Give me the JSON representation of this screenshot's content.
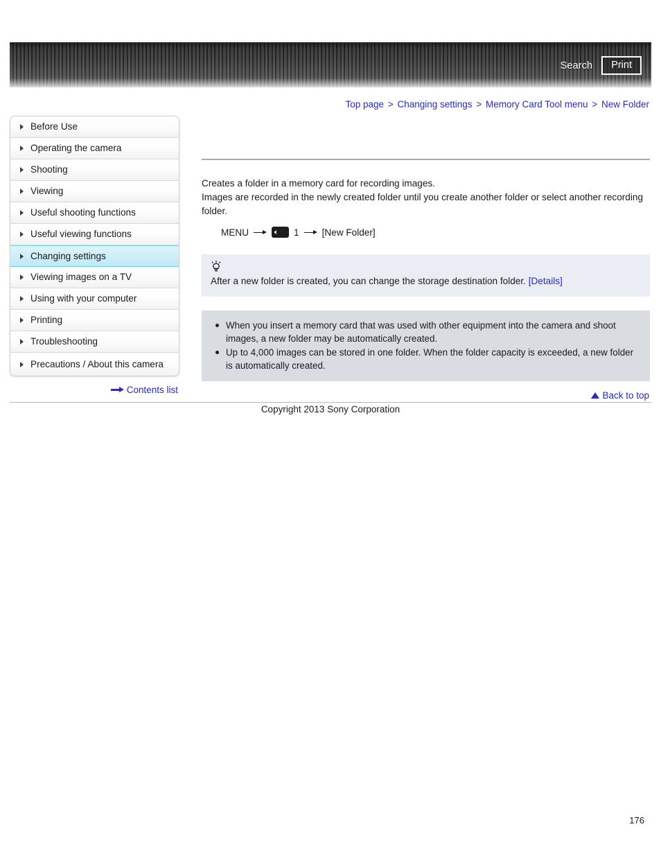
{
  "header": {
    "search_label": "Search",
    "print_label": "Print",
    "search_icon": "search-icon",
    "print_icon": "print-icon"
  },
  "breadcrumb": {
    "separator": ">",
    "items": [
      "Top page",
      "Changing settings",
      "Memory Card Tool menu",
      "New Folder"
    ]
  },
  "sidebar": {
    "items": [
      {
        "label": "Before Use",
        "active": false
      },
      {
        "label": "Operating the camera",
        "active": false
      },
      {
        "label": "Shooting",
        "active": false
      },
      {
        "label": "Viewing",
        "active": false
      },
      {
        "label": "Useful shooting functions",
        "active": false
      },
      {
        "label": "Useful viewing functions",
        "active": false
      },
      {
        "label": "Changing settings",
        "active": true
      },
      {
        "label": "Viewing images on a TV",
        "active": false
      },
      {
        "label": "Using with your computer",
        "active": false
      },
      {
        "label": "Printing",
        "active": false
      },
      {
        "label": "Troubleshooting",
        "active": false
      },
      {
        "label": "Precautions / About this camera",
        "active": false
      }
    ],
    "contents_list_label": "Contents list",
    "contents_list_icon": "arrow-right-icon"
  },
  "main": {
    "paragraph_1": "Creates a folder in a memory card for recording images.",
    "paragraph_2": "Images are recorded in the newly created folder until you create another folder or select another recording folder.",
    "menu_path": {
      "menu_label": "MENU",
      "card_icon": "memory-card-icon",
      "card_number": "1",
      "destination": "[New Folder]",
      "arrow_icon": "arrow-right-icon"
    },
    "tip": {
      "icon": "light-bulb-icon",
      "text": "After a new folder is created, you can change the storage destination folder.",
      "link_label": "[Details]"
    },
    "notes": [
      "When you insert a memory card that was used with other equipment into the camera and shoot images, a new folder may be automatically created.",
      "Up to 4,000 images can be stored in one folder. When the folder capacity is exceeded, a new folder is automatically created."
    ]
  },
  "footer": {
    "back_to_top_label": "Back to top",
    "back_to_top_icon": "triangle-up-icon",
    "copyright": "Copyright 2013 Sony Corporation",
    "page_number": "176"
  },
  "colors": {
    "link": "#2a2ac0",
    "active_nav_bg": "#cdeef8",
    "active_nav_border": "#74d2ee",
    "tip_bg": "#eaeef4",
    "notes_bg": "#d9dde1",
    "header_bg": "#3a3a3a"
  }
}
